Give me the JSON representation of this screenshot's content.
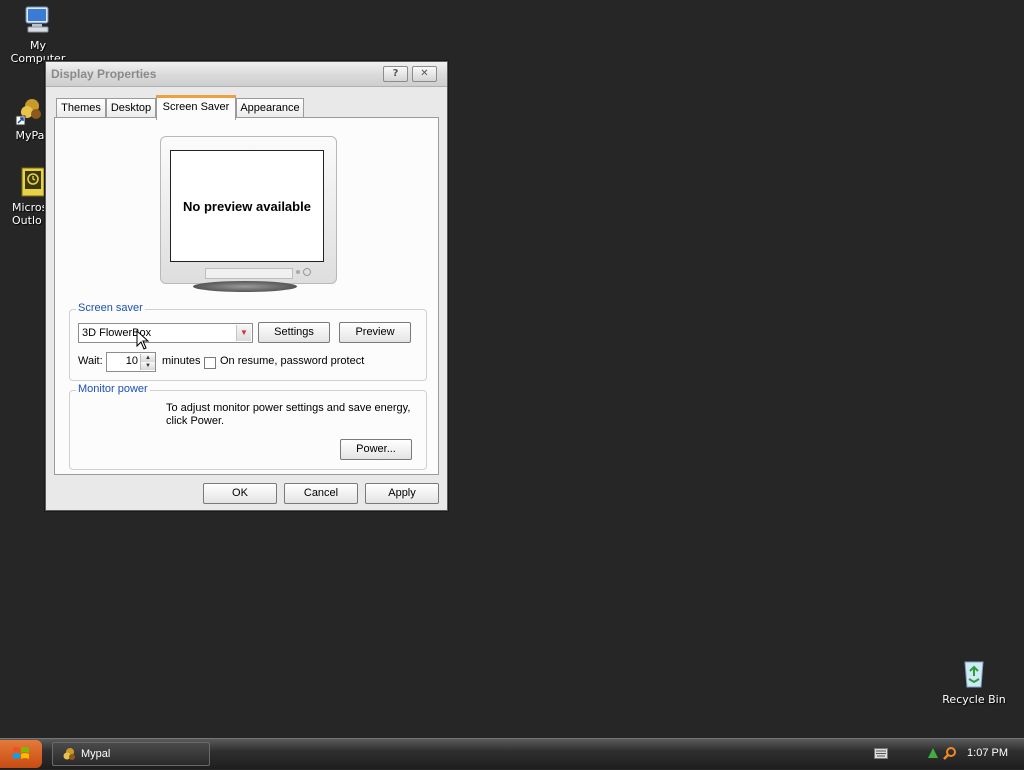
{
  "desktop": {
    "icons": [
      {
        "label": "My Computer",
        "icon": "my-computer-icon"
      },
      {
        "label": "MyPa",
        "icon": "mypal-icon"
      },
      {
        "label": "Micros Outlo",
        "icon": "outlook-icon"
      },
      {
        "label": "Recycle Bin",
        "icon": "recycle-bin-icon"
      }
    ]
  },
  "window": {
    "title": "Display Properties",
    "help_label": "?",
    "close_label": "✕",
    "tabs": [
      {
        "label": "Themes"
      },
      {
        "label": "Desktop"
      },
      {
        "label": "Screen Saver",
        "active": true
      },
      {
        "label": "Appearance"
      }
    ],
    "preview_text": "No preview available",
    "screensaver": {
      "group_label": "Screen saver",
      "selected": "3D FlowerBox",
      "settings_label": "Settings",
      "preview_label": "Preview",
      "wait_label": "Wait:",
      "wait_value": "10",
      "minutes_label": "minutes",
      "password_label": "On resume, password protect",
      "password_checked": false
    },
    "monitor_power": {
      "group_label": "Monitor power",
      "description": "To adjust monitor power settings and save energy, click Power.",
      "power_label": "Power..."
    },
    "buttons": {
      "ok": "OK",
      "cancel": "Cancel",
      "apply": "Apply"
    }
  },
  "taskbar": {
    "task_label": "Mypal",
    "clock": "1:07 PM"
  },
  "colors": {
    "desktop": "#262626",
    "group_label": "#1a4fb8",
    "active_tab_accent": "#f0a040",
    "start_button": "#d45a1c"
  }
}
